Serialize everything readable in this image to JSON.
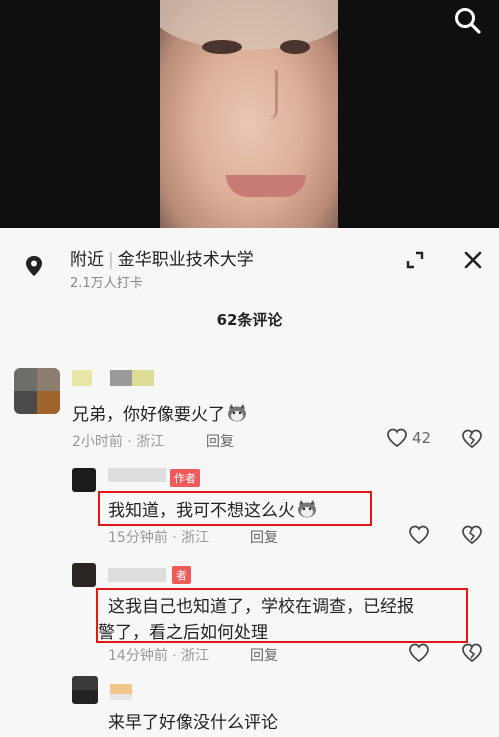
{
  "location": {
    "prefix": "附近",
    "name": "金华职业技术大学",
    "checkins": "2.1万人打卡"
  },
  "comments_count": "62条评论",
  "comments": [
    {
      "text": "兄弟，你好像要火了",
      "time_loc": "2小时前 · 浙江",
      "reply_label": "回复",
      "likes": "42",
      "emoji_icon": "husky-dog-emoji"
    },
    {
      "author_tag": "作者",
      "text": "我知道，我可不想这么火",
      "time_loc": "15分钟前 · 浙江",
      "reply_label": "回复",
      "emoji_icon": "husky-dog-emoji",
      "highlighted": true
    },
    {
      "author_tag": "者",
      "text_line1": "这我自己也知道了，学校在调查，已经报",
      "text_line2": "警了，看之后如何处理",
      "time_loc": "14分钟前 · 浙江",
      "reply_label": "回复",
      "highlighted": true
    },
    {
      "text": "来早了好像没什么评论"
    }
  ],
  "colors": {
    "highlight_box": "#e01818",
    "author_tag": "#f25a5a",
    "sheet_bg": "#f7f7f7"
  }
}
